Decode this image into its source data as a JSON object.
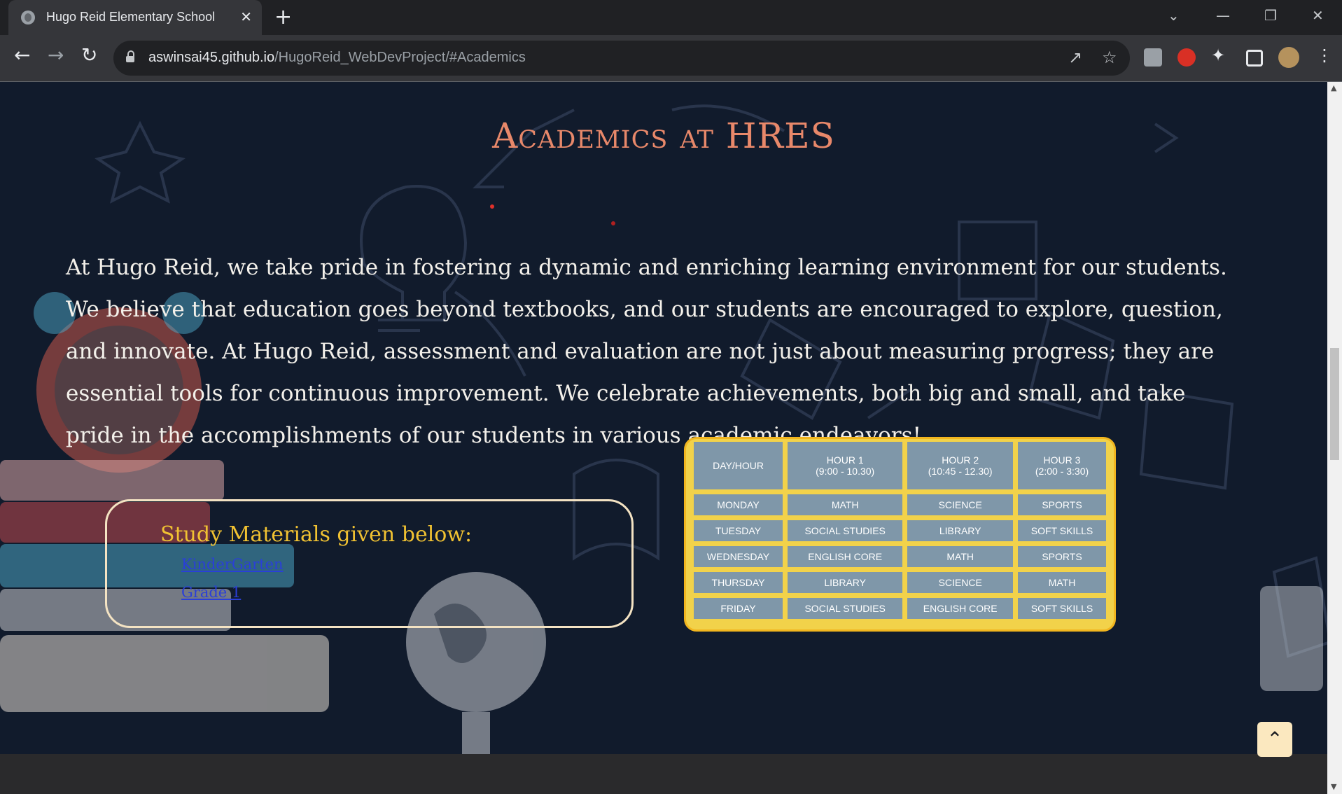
{
  "browser": {
    "tab_title": "Hugo Reid Elementary School",
    "tab_close": "✕",
    "new_tab": "+",
    "url_host": "aswinsai45.github.io",
    "url_path": "/HugoReid_WebDevProject/#Academics",
    "window_controls": [
      "⌄",
      "—",
      "❐",
      "✕"
    ]
  },
  "page": {
    "heading": "Academics at HRES",
    "intro": "At Hugo Reid, we take pride in fostering a dynamic and enriching learning environment for our students. We believe that education goes beyond textbooks, and our students are encouraged to explore, question, and innovate. At Hugo Reid, assessment and evaluation are not just about measuring progress; they are essential tools for continuous improvement. We celebrate achievements, both big and small, and take pride in the accomplishments of our students in various academic endeavors!",
    "materials": {
      "title": "Study Materials given below:",
      "links": [
        "KinderGarten",
        "Grade 1"
      ]
    },
    "timetable": {
      "headers": [
        "DAY/HOUR",
        "HOUR 1\n(9:00 - 10.30)",
        "HOUR 2\n(10:45 - 12.30)",
        "HOUR 3\n(2:00 - 3:30)"
      ],
      "rows": [
        [
          "MONDAY",
          "MATH",
          "SCIENCE",
          "SPORTS"
        ],
        [
          "TUESDAY",
          "SOCIAL STUDIES",
          "LIBRARY",
          "SOFT SKILLS"
        ],
        [
          "WEDNESDAY",
          "ENGLISH CORE",
          "MATH",
          "SPORTS"
        ],
        [
          "THURSDAY",
          "LIBRARY",
          "SCIENCE",
          "MATH"
        ],
        [
          "FRIDAY",
          "SOCIAL STUDIES",
          "ENGLISH CORE",
          "SOFT SKILLS"
        ]
      ]
    },
    "scroll_top_icon": "chevron-double-up-icon"
  }
}
